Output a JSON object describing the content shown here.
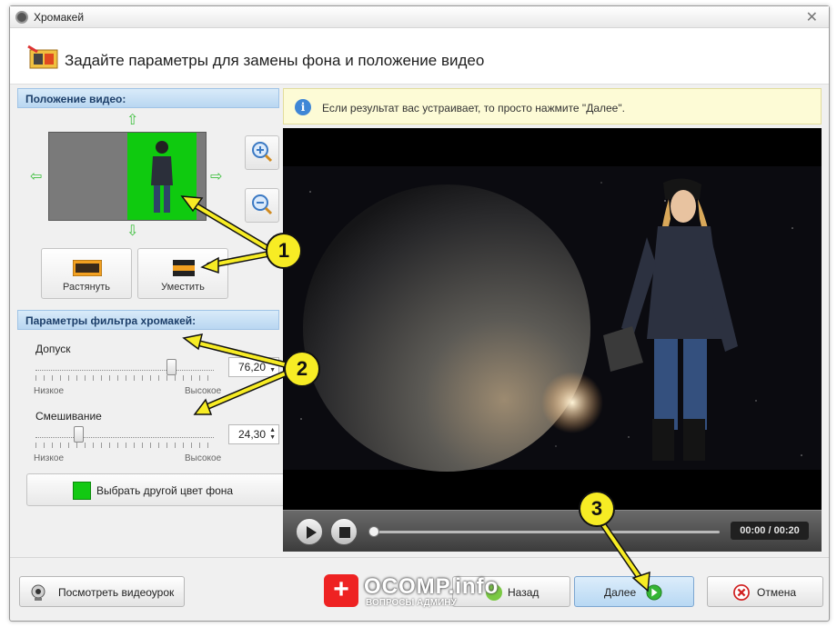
{
  "window": {
    "title": "Хромакей"
  },
  "header": {
    "title": "Задайте параметры для замены фона и положение видео"
  },
  "video_position": {
    "section_title": "Положение видео:",
    "stretch_label": "Растянуть",
    "fit_label": "Уместить"
  },
  "chroma_filter": {
    "section_title": "Параметры фильтра хромакей:",
    "tolerance": {
      "label": "Допуск",
      "value": "76,20",
      "level": 0.76,
      "low_label": "Низкое",
      "high_label": "Высокое"
    },
    "blending": {
      "label": "Смешивание",
      "value": "24,30",
      "level": 0.24,
      "low_label": "Низкое",
      "high_label": "Высокое"
    },
    "pick_color_label": "Выбрать другой цвет фона",
    "key_color": "#12c912"
  },
  "info": {
    "text": "Если результат вас устраивает, то просто нажмите \"Далее\"."
  },
  "player": {
    "time": "00:00 / 00:20",
    "progress": 0.0
  },
  "footer": {
    "tutorial_label": "Посмотреть видеоурок",
    "back_label": "Назад",
    "next_label": "Далее",
    "cancel_label": "Отмена"
  },
  "annotations": [
    "1",
    "2",
    "3"
  ],
  "watermark": {
    "brand": "OCOMP.info",
    "tagline": "ВОПРОСЫ АДМИНУ"
  },
  "colors": {
    "accent": "#f7ec24",
    "section_header": "#b9d7f1",
    "key_green": "#12c912"
  }
}
